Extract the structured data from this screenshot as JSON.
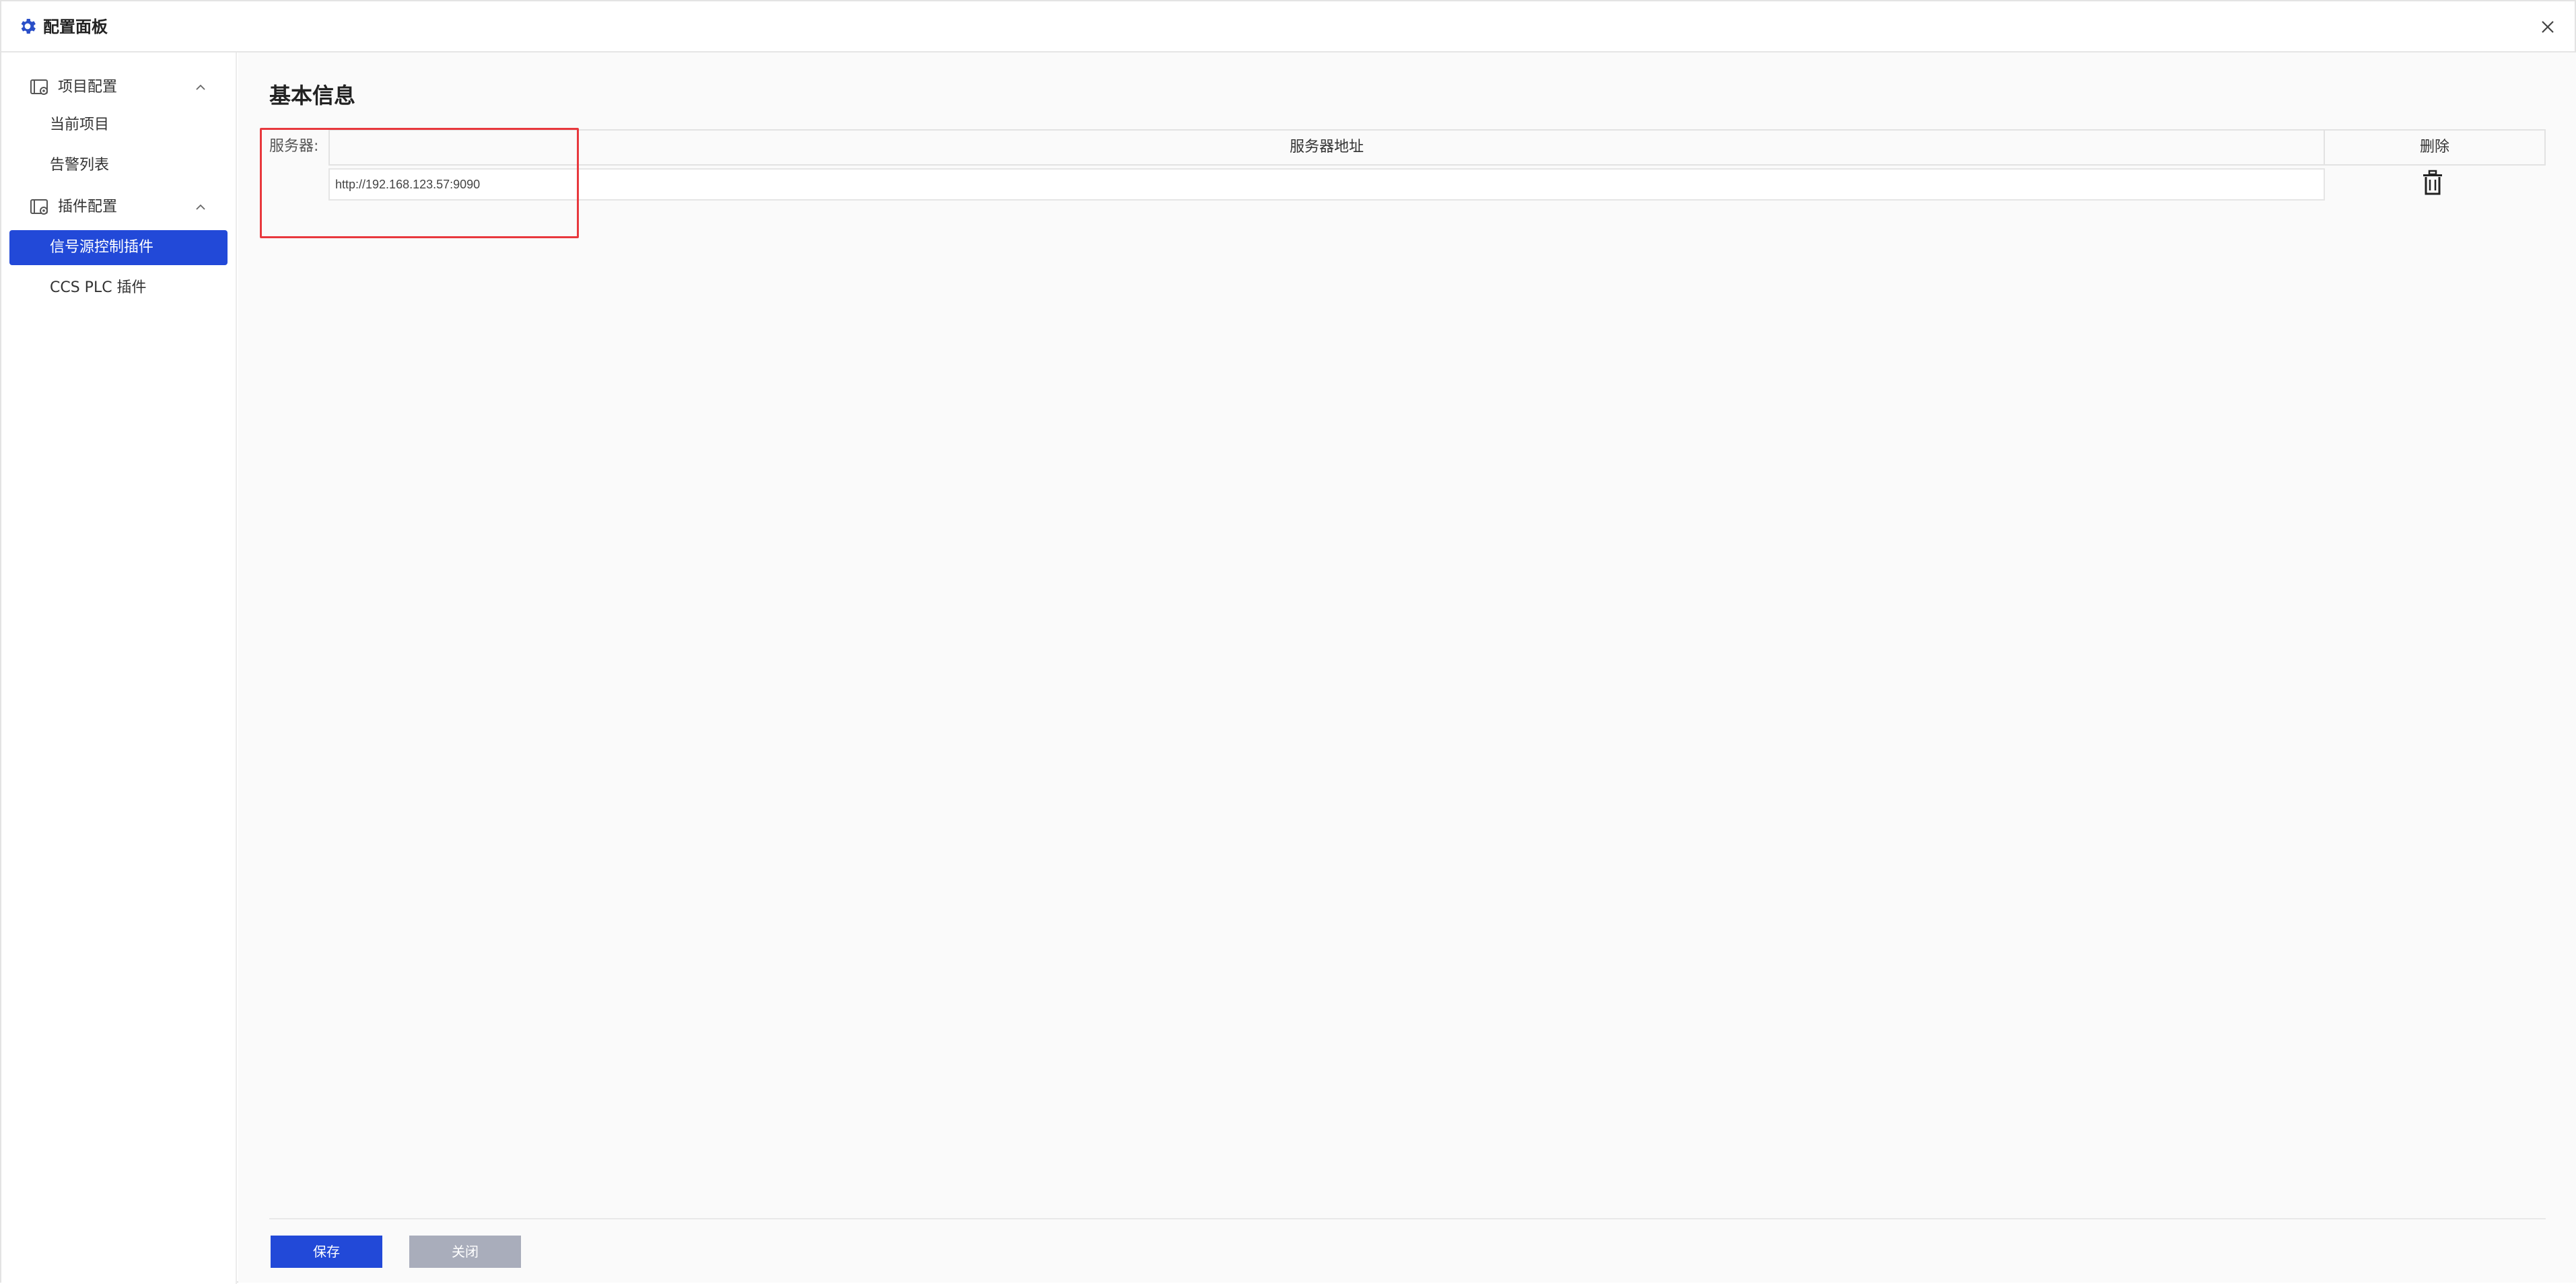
{
  "window": {
    "title": "配置面板",
    "title_icon": "gear-icon",
    "close_icon": "close-icon"
  },
  "sidebar": {
    "groups": [
      {
        "label": "项目配置",
        "icon": "settings-window-icon",
        "expanded": true,
        "items": [
          {
            "label": "当前项目",
            "active": false
          },
          {
            "label": "告警列表",
            "active": false
          }
        ]
      },
      {
        "label": "插件配置",
        "icon": "settings-window-icon",
        "expanded": true,
        "items": [
          {
            "label": "信号源控制插件",
            "active": true
          },
          {
            "label": "CCS PLC 插件",
            "active": false
          }
        ]
      }
    ]
  },
  "main": {
    "section_title": "基本信息",
    "server_label": "服务器:",
    "table": {
      "columns": [
        "服务器地址",
        "删除"
      ],
      "rows": [
        {
          "address": "http://192.168.123.57:9090",
          "delete_icon": "trash-icon"
        }
      ]
    },
    "buttons": {
      "save": "保存",
      "close": "关闭"
    }
  },
  "colors": {
    "accent": "#2249d8",
    "highlight": "#e8383d",
    "disabled_button": "#a9adbb"
  }
}
